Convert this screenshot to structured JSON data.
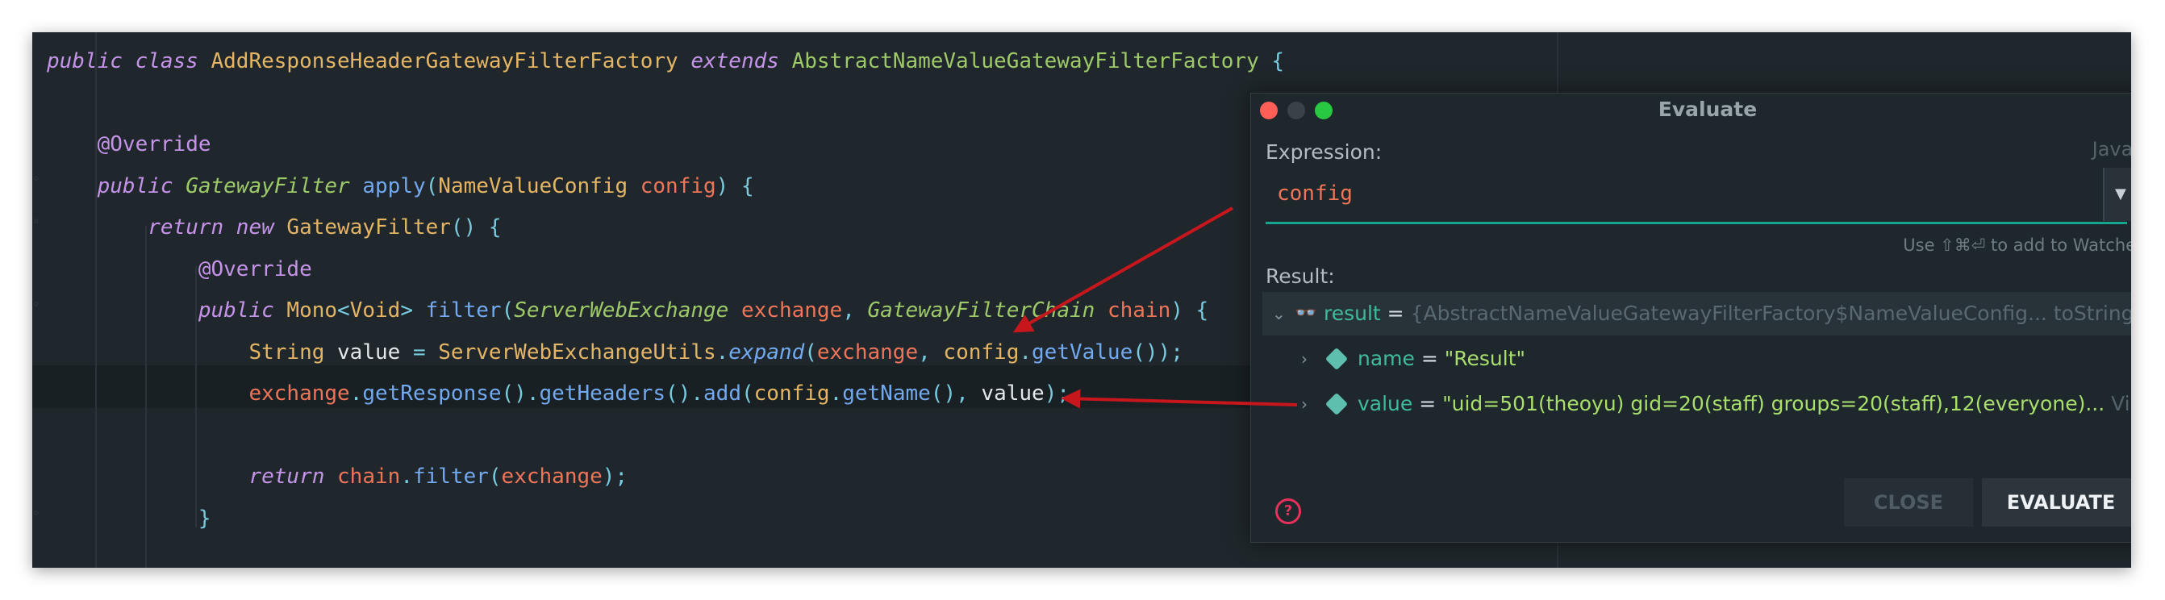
{
  "editor": {
    "lines": [
      [
        {
          "t": "public class ",
          "c": "kw"
        },
        {
          "t": "AddResponseHeaderGatewayFilterFactory ",
          "c": "cls"
        },
        {
          "t": "extends ",
          "c": "kw"
        },
        {
          "t": "AbstractNameValueGatewayFilterFactory ",
          "c": "cls2"
        },
        {
          "t": "{",
          "c": "op"
        }
      ],
      [],
      [
        {
          "t": "    "
        },
        {
          "t": "@Override",
          "c": "ann"
        }
      ],
      [
        {
          "t": "    "
        },
        {
          "t": "public ",
          "c": "kw"
        },
        {
          "t": "GatewayFilter ",
          "c": "ital2"
        },
        {
          "t": "apply",
          "c": "fn"
        },
        {
          "t": "(",
          "c": "op"
        },
        {
          "t": "NameValueConfig ",
          "c": "cls"
        },
        {
          "t": "config",
          "c": "par"
        },
        {
          "t": ") {",
          "c": "op"
        }
      ],
      [
        {
          "t": "        "
        },
        {
          "t": "return new ",
          "c": "kw"
        },
        {
          "t": "GatewayFilter",
          "c": "cls"
        },
        {
          "t": "() {",
          "c": "op"
        }
      ],
      [
        {
          "t": "            "
        },
        {
          "t": "@Override",
          "c": "ann"
        }
      ],
      [
        {
          "t": "            "
        },
        {
          "t": "public ",
          "c": "kw"
        },
        {
          "t": "Mono",
          "c": "cls"
        },
        {
          "t": "<",
          "c": "op"
        },
        {
          "t": "Void",
          "c": "cls"
        },
        {
          "t": "> ",
          "c": "op"
        },
        {
          "t": "filter",
          "c": "fn"
        },
        {
          "t": "(",
          "c": "op"
        },
        {
          "t": "ServerWebExchange ",
          "c": "ital2"
        },
        {
          "t": "exchange",
          "c": "par"
        },
        {
          "t": ", ",
          "c": "op"
        },
        {
          "t": "GatewayFilterChain ",
          "c": "ital2"
        },
        {
          "t": "chain",
          "c": "par"
        },
        {
          "t": ") {",
          "c": "op"
        }
      ],
      [
        {
          "t": "                "
        },
        {
          "t": "String ",
          "c": "cls"
        },
        {
          "t": "value ",
          "c": "plain"
        },
        {
          "t": "= ",
          "c": "op"
        },
        {
          "t": "ServerWebExchangeUtils",
          "c": "cls"
        },
        {
          "t": ".",
          "c": "op"
        },
        {
          "t": "expand",
          "c": "fni"
        },
        {
          "t": "(",
          "c": "op"
        },
        {
          "t": "exchange",
          "c": "par"
        },
        {
          "t": ", ",
          "c": "op"
        },
        {
          "t": "config",
          "c": "hl"
        },
        {
          "t": ".",
          "c": "op"
        },
        {
          "t": "getValue",
          "c": "fn"
        },
        {
          "t": "());",
          "c": "op"
        }
      ],
      [
        {
          "t": "                "
        },
        {
          "t": "exchange",
          "c": "par"
        },
        {
          "t": ".",
          "c": "op"
        },
        {
          "t": "getResponse",
          "c": "fn"
        },
        {
          "t": "().",
          "c": "op"
        },
        {
          "t": "getHeaders",
          "c": "fn"
        },
        {
          "t": "().",
          "c": "op"
        },
        {
          "t": "add",
          "c": "fn"
        },
        {
          "t": "(",
          "c": "op"
        },
        {
          "t": "config",
          "c": "hl"
        },
        {
          "t": ".",
          "c": "op"
        },
        {
          "t": "getName",
          "c": "fn"
        },
        {
          "t": "(), ",
          "c": "op"
        },
        {
          "t": "value",
          "c": "plain"
        },
        {
          "t": ");",
          "c": "op"
        }
      ],
      [],
      [
        {
          "t": "                "
        },
        {
          "t": "return ",
          "c": "kw"
        },
        {
          "t": "chain",
          "c": "par"
        },
        {
          "t": ".",
          "c": "op"
        },
        {
          "t": "filter",
          "c": "fn"
        },
        {
          "t": "(",
          "c": "op"
        },
        {
          "t": "exchange",
          "c": "par"
        },
        {
          "t": ");",
          "c": "op"
        }
      ],
      [
        {
          "t": "            "
        },
        {
          "t": "}",
          "c": "op"
        }
      ]
    ]
  },
  "dialog": {
    "title": "Evaluate",
    "expression_label": "Expression:",
    "language": "Java",
    "expression_value": "config",
    "watch_hint": "Use ⇧⌘⏎ to add to Watches",
    "result_label": "Result:",
    "result": {
      "name": "result",
      "eq": " = ",
      "value": "{AbstractNameValueGatewayFilterFactory$NameValueConfig...",
      "tostring": " toString()",
      "children": [
        {
          "name": "name",
          "eq": " = ",
          "value": "\"Result\"",
          "suffix": ""
        },
        {
          "name": "value",
          "eq": " = ",
          "value": "\"uid=501(theoyu) gid=20(staff) groups=20(staff),12(everyone)...",
          "suffix": " View"
        }
      ]
    },
    "close_label": "CLOSE",
    "evaluate_label": "EVALUATE",
    "help_glyph": "?"
  },
  "colors": {
    "traffic_close": "#ff5f57",
    "traffic_min": "#3a4247",
    "traffic_zoom": "#28c840",
    "arrow": "#c8161d"
  }
}
